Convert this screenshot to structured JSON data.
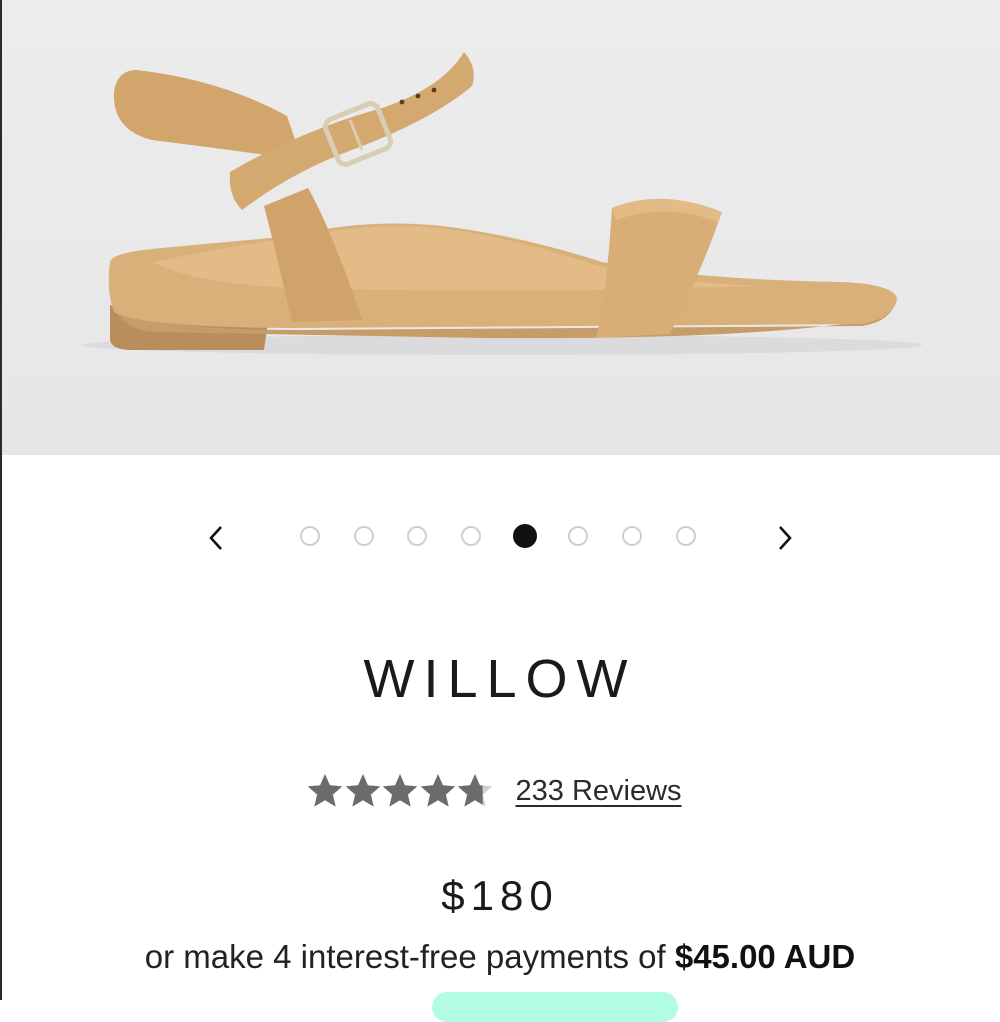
{
  "product": {
    "name": "WILLOW",
    "image_alt": "tan leather flat sandal with ankle strap and buckle",
    "rating": 4.7,
    "rating_max": 5,
    "reviews_label": "233 Reviews",
    "price": "$180",
    "installments": {
      "prefix": "or make 4 interest-free payments of ",
      "amount": "$45.00 AUD"
    }
  },
  "carousel": {
    "prev_icon": "chevron-left-icon",
    "next_icon": "chevron-right-icon",
    "slide_count": 8,
    "active_index": 4
  },
  "colors": {
    "sandal_tan": "#d4ac72",
    "sandal_shadow": "#b98f57",
    "sole": "#b98d5c",
    "star": "#6b6b6b",
    "afterpay_mint": "#b2fce4"
  }
}
